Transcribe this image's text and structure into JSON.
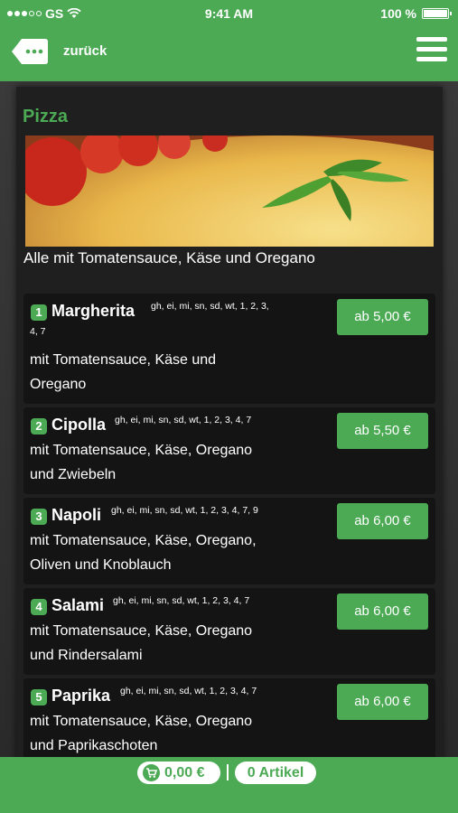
{
  "status": {
    "carrier": "GS",
    "time": "9:41 AM",
    "battery": "100 %"
  },
  "nav": {
    "back_label": "zurück"
  },
  "category": {
    "title": "Pizza",
    "description": "Alle mit Tomatensauce, Käse und Oregano"
  },
  "items": [
    {
      "num": "1",
      "name": "Margherita",
      "allergens": "gh, ei, mi, sn, sd, wt, 1, 2, 3,",
      "allergens_2": "4, 7",
      "desc_1": "mit Tomatensauce, Käse und",
      "desc_2": "Oregano",
      "price": "ab 5,00 €"
    },
    {
      "num": "2",
      "name": "Cipolla",
      "allergens": "gh, ei, mi, sn, sd, wt, 1, 2, 3, 4, 7",
      "desc_1": "mit Tomatensauce, Käse, Oregano",
      "desc_2": "und Zwiebeln",
      "price": "ab 5,50 €"
    },
    {
      "num": "3",
      "name": "Napoli",
      "allergens": "gh, ei, mi, sn, sd, wt, 1, 2, 3, 4, 7, 9",
      "desc_1": "mit Tomatensauce, Käse, Oregano,",
      "desc_2": "Oliven und Knoblauch",
      "price": "ab 6,00 €"
    },
    {
      "num": "4",
      "name": "Salami",
      "allergens": "gh, ei, mi, sn, sd, wt, 1, 2, 3, 4, 7",
      "desc_1": "mit Tomatensauce, Käse, Oregano",
      "desc_2": "und Rindersalami",
      "price": "ab 6,00 €"
    },
    {
      "num": "5",
      "name": "Paprika",
      "allergens": "gh, ei, mi, sn, sd, wt, 1, 2, 3, 4, 7",
      "desc_1": "mit Tomatensauce, Käse, Oregano",
      "desc_2": "und Paprikaschoten",
      "price": "ab 6,00 €"
    }
  ],
  "cart": {
    "total": "0,00 €",
    "count": "0 Artikel"
  },
  "colors": {
    "accent": "#4caa55",
    "panel": "#1f1f1f",
    "card": "#141414"
  }
}
